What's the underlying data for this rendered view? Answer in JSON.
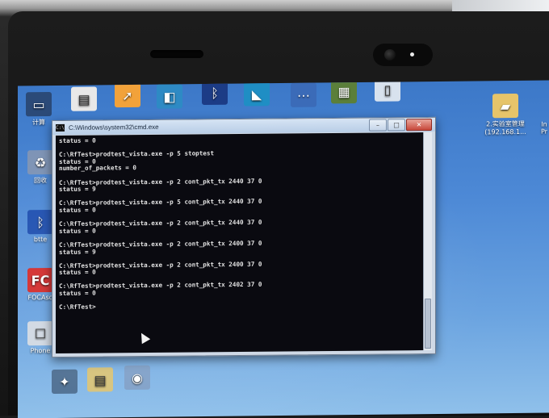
{
  "window": {
    "icon_text": "C:\\",
    "title": "C:\\Windows\\system32\\cmd.exe",
    "minimize": "–",
    "maximize": "□",
    "close": "✕"
  },
  "console_lines": [
    "status = 0",
    "",
    "C:\\RfTest>prodtest_vista.exe -p 5 stoptest",
    "status = 0",
    "number_of_packets = 0",
    "",
    "C:\\RfTest>prodtest_vista.exe -p 2 cont_pkt_tx 2440 37 0",
    "status = 9",
    "",
    "C:\\RfTest>prodtest_vista.exe -p 5 cont_pkt_tx 2440 37 0",
    "status = 0",
    "",
    "C:\\RfTest>prodtest_vista.exe -p 2 cont_pkt_tx 2440 37 0",
    "status = 0",
    "",
    "C:\\RfTest>prodtest_vista.exe -p 2 cont_pkt_tx 2400 37 0",
    "status = 9",
    "",
    "C:\\RfTest>prodtest_vista.exe -p 2 cont_pkt_tx 2400 37 0",
    "status = 0",
    "",
    "C:\\RfTest>prodtest_vista.exe -p 2 cont_pkt_tx 2402 37 0",
    "status = 0",
    "",
    "C:\\RfTest>"
  ],
  "desktop_icons": [
    {
      "label": "计算",
      "icon": "computer-icon"
    },
    {
      "label": "回收",
      "icon": "recycle-bin-icon"
    },
    {
      "label": "btte",
      "icon": "bluetooth-icon"
    },
    {
      "label": "FOCAso",
      "icon": "focas-icon"
    },
    {
      "label": "Phone",
      "icon": "phone-icon"
    },
    {
      "label": "2.实验室管理",
      "icon": "folder-icon"
    },
    {
      "label": "(192.168.1...",
      "icon": ""
    },
    {
      "label": "In",
      "icon": ""
    },
    {
      "label": "Pr",
      "icon": ""
    }
  ],
  "colors": {
    "desktop": "#3c78c8",
    "console_bg": "#0a0a10",
    "console_text": "#e4e4e4",
    "close_button": "#c7473a"
  }
}
